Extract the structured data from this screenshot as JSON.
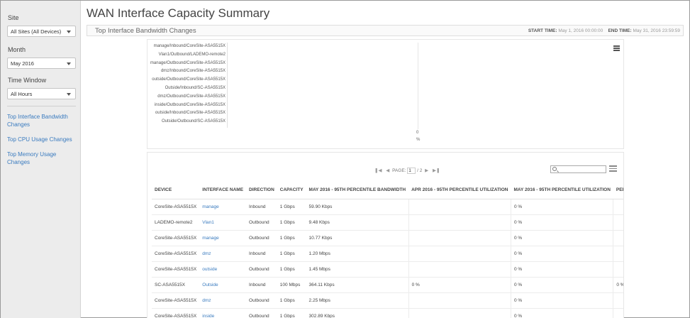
{
  "sidebar": {
    "site_label": "Site",
    "site_value": "All Sites (All Devices)",
    "month_label": "Month",
    "month_value": "May 2016",
    "window_label": "Time Window",
    "window_value": "All Hours",
    "links": [
      "Top Interface Bandwidth Changes",
      "Top CPU Usage Changes",
      "Top Memory Usage Changes"
    ]
  },
  "page": {
    "title": "WAN Interface Capacity Summary"
  },
  "section": {
    "title": "Top Interface Bandwidth Changes",
    "start_label": "START TIME:",
    "start_value": "May 1, 2016 00:00:00",
    "end_label": "END TIME:",
    "end_value": "May 31, 2016 23:59:59"
  },
  "chart_data": {
    "type": "bar",
    "categories": [
      "manage/Inbound/CoreSite-ASA5515X",
      "Vlan1/Outbound/LADEMO-remote2",
      "manage/Outbound/CoreSite-ASA5515X",
      "dmz/Inbound/CoreSite-ASA5515X",
      "outside/Outbound/CoreSite-ASA5515X",
      "Outside/Inbound/SC-ASA5515X",
      "dmz/Outbound/CoreSite-ASA5515X",
      "inside/Outbound/CoreSite-ASA5515X",
      "outside/Inbound/CoreSite-ASA5515X",
      "Outside/Outbound/SC-ASA5515X"
    ],
    "values": [
      0,
      0,
      0,
      0,
      0,
      0,
      0,
      0,
      0,
      0
    ],
    "x_tick": "0",
    "x_unit": "%"
  },
  "table": {
    "pager": {
      "page_label": "PAGE:",
      "page_value": "1",
      "page_total": "/ 2"
    },
    "columns": [
      "DEVICE",
      "INTERFACE NAME",
      "DIRECTION",
      "CAPACITY",
      "MAY 2016 - 95TH PERCENTILE BANDWIDTH",
      "APR 2016 - 95TH PERCENTILE UTILIZATION",
      "MAY 2016 - 95TH PERCENTILE UTILIZATION",
      "PERCEN"
    ],
    "rows": [
      [
        "CoreSite-ASA5515X",
        "manage",
        "Inbound",
        "1 Gbps",
        "59.90 Kbps",
        "",
        "0 %",
        ""
      ],
      [
        "LADEMO-remote2",
        "Vlan1",
        "Outbound",
        "1 Gbps",
        "9.48 Kbps",
        "",
        "0 %",
        ""
      ],
      [
        "CoreSite-ASA5515X",
        "manage",
        "Outbound",
        "1 Gbps",
        "10.77 Kbps",
        "",
        "0 %",
        ""
      ],
      [
        "CoreSite-ASA5515X",
        "dmz",
        "Inbound",
        "1 Gbps",
        "1.20 Mbps",
        "",
        "0 %",
        ""
      ],
      [
        "CoreSite-ASA5515X",
        "outside",
        "Outbound",
        "1 Gbps",
        "1.45 Mbps",
        "",
        "0 %",
        ""
      ],
      [
        "SC-ASA5515X",
        "Outside",
        "Inbound",
        "100 Mbps",
        "364.11 Kbps",
        "0 %",
        "0 %",
        "0 %"
      ],
      [
        "CoreSite-ASA5515X",
        "dmz",
        "Outbound",
        "1 Gbps",
        "2.25 Mbps",
        "",
        "0 %",
        ""
      ],
      [
        "CoreSite-ASA5515X",
        "inside",
        "Outbound",
        "1 Gbps",
        "302.89 Kbps",
        "",
        "0 %",
        ""
      ]
    ]
  }
}
